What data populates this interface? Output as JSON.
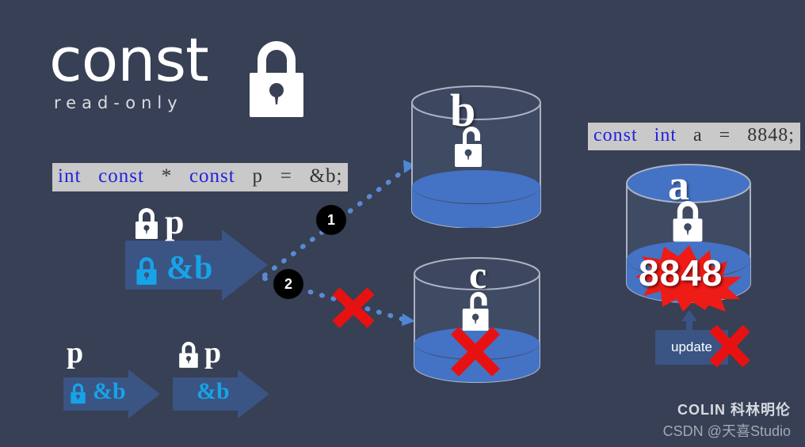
{
  "title": {
    "main": "const",
    "sub": "read-only",
    "lock_icon": "closed-padlock-icon"
  },
  "colors": {
    "background": "#374054",
    "arrow_fill": "#3a5484",
    "cylinder_blue": "#4472c4",
    "cylinder_body": "#3f4a63",
    "accent_cyan": "#17a3e8",
    "keyword_blue": "#2222dd",
    "code_chip_bg": "#c9c9c9",
    "error_red": "#e81111",
    "circle_black": "#000000"
  },
  "code_left": {
    "tokens": [
      {
        "text": "int",
        "keyword": true
      },
      {
        "text": "const",
        "keyword": true
      },
      {
        "text": "*",
        "keyword": false
      },
      {
        "text": "const",
        "keyword": true
      },
      {
        "text": "p",
        "keyword": false
      },
      {
        "text": "=",
        "keyword": false
      },
      {
        "text": "&b;",
        "keyword": false
      }
    ],
    "full_text": "int const * const p = &b;"
  },
  "code_right": {
    "tokens": [
      {
        "text": "const",
        "keyword": true
      },
      {
        "text": "int",
        "keyword": true
      },
      {
        "text": "a",
        "keyword": false
      },
      {
        "text": "=",
        "keyword": false
      },
      {
        "text": "8848;",
        "keyword": false
      }
    ],
    "full_text": "const int a = 8848;"
  },
  "pointer_arrows": [
    {
      "id": "main",
      "label": "p",
      "label_lock": "closed-padlock-icon",
      "inner": "&b",
      "inner_lock": "closed-padlock-icon"
    },
    {
      "id": "value-mutable",
      "label": "p",
      "label_lock": null,
      "inner": "&b",
      "inner_lock": "closed-padlock-icon"
    },
    {
      "id": "pointer-const",
      "label": "p",
      "label_lock": "closed-padlock-icon",
      "inner": "&b",
      "inner_lock": null
    }
  ],
  "steps": [
    {
      "number": "1",
      "allowed": true
    },
    {
      "number": "2",
      "allowed": false,
      "block_marker": "red-x-icon"
    }
  ],
  "cylinders": [
    {
      "id": "b",
      "letter": "b",
      "lock": "open-padlock-icon",
      "lock_state": "unlocked",
      "value": null,
      "blocked": false,
      "top_filled": false
    },
    {
      "id": "c",
      "letter": "c",
      "lock": "open-padlock-icon",
      "lock_state": "unlocked",
      "value": null,
      "blocked": true,
      "block_marker": "red-x-icon",
      "top_filled": false
    },
    {
      "id": "a",
      "letter": "a",
      "lock": "closed-padlock-icon",
      "lock_state": "locked",
      "value": "8848",
      "blocked": false,
      "top_filled": true
    }
  ],
  "update_action": {
    "label": "update",
    "blocked": true,
    "block_marker": "red-x-icon"
  },
  "watermark": {
    "brand": "COLIN 科林明伦",
    "author": "CSDN @天喜Studio"
  }
}
